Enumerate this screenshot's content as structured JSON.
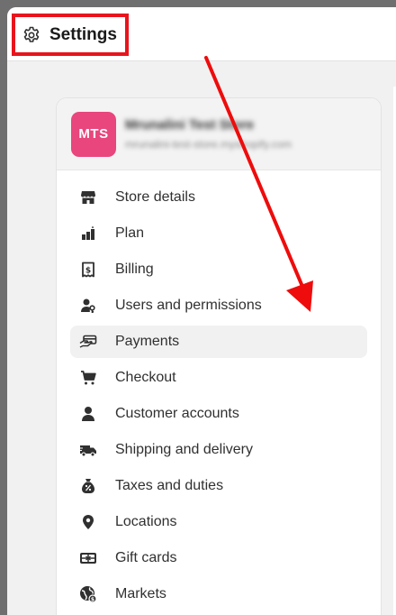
{
  "header": {
    "title": "Settings",
    "icon": "gear-icon"
  },
  "store": {
    "avatar_initials": "MTS",
    "avatar_color": "#e8467c",
    "name": "Mrunalini Test Store",
    "domain": "mrunalini-test-store.myshopify.com"
  },
  "menu": {
    "items": [
      {
        "label": "Store details",
        "icon": "store-icon"
      },
      {
        "label": "Plan",
        "icon": "plan-icon"
      },
      {
        "label": "Billing",
        "icon": "billing-icon"
      },
      {
        "label": "Users and permissions",
        "icon": "users-icon"
      },
      {
        "label": "Payments",
        "icon": "payments-icon",
        "active": true
      },
      {
        "label": "Checkout",
        "icon": "cart-icon"
      },
      {
        "label": "Customer accounts",
        "icon": "person-icon"
      },
      {
        "label": "Shipping and delivery",
        "icon": "truck-icon"
      },
      {
        "label": "Taxes and duties",
        "icon": "tax-icon"
      },
      {
        "label": "Locations",
        "icon": "location-pin-icon"
      },
      {
        "label": "Gift cards",
        "icon": "gift-card-icon"
      },
      {
        "label": "Markets",
        "icon": "globe-icon"
      }
    ]
  },
  "annotation": {
    "highlight_color": "#e8141c"
  }
}
